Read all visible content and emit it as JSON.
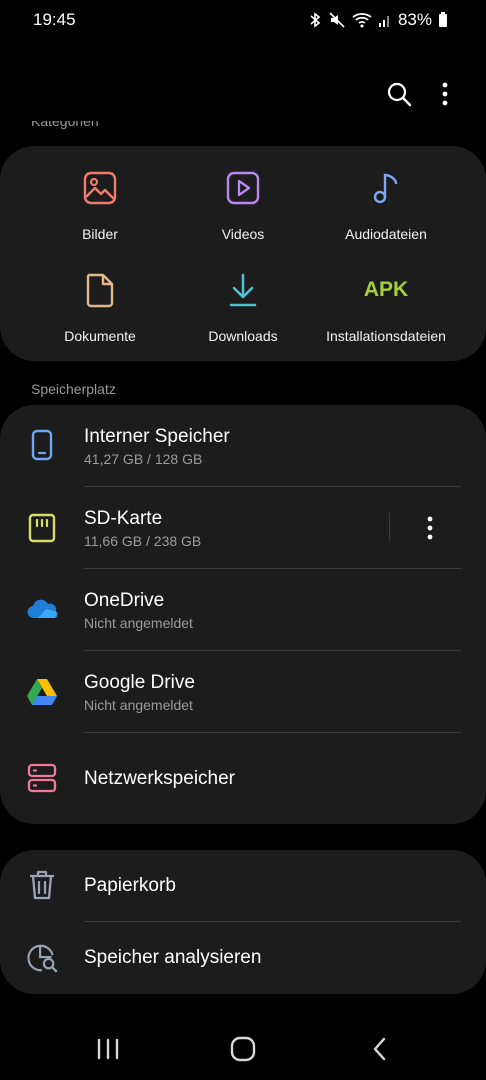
{
  "status": {
    "time": "19:45",
    "battery": "83%",
    "icons": [
      "bluetooth-icon",
      "mute-icon",
      "wifi-icon",
      "signal-icon",
      "battery-icon"
    ]
  },
  "toolbar": {
    "icons": [
      "search-icon",
      "more-options-icon"
    ]
  },
  "categories": {
    "header": "Kategorien",
    "items": [
      {
        "label": "Bilder",
        "icon": "image-icon",
        "color": "#f07d6c"
      },
      {
        "label": "Videos",
        "icon": "video-icon",
        "color": "#b889f0"
      },
      {
        "label": "Audiodateien",
        "icon": "audio-icon",
        "color": "#7ea6f4"
      },
      {
        "label": "Dokumente",
        "icon": "document-icon",
        "color": "#e3b989"
      },
      {
        "label": "Downloads",
        "icon": "download-icon",
        "color": "#4fc3d6"
      },
      {
        "label": "Installationsdateien",
        "icon": "apk-icon",
        "apk_text": "APK",
        "color": "#a6d03a"
      }
    ]
  },
  "storage": {
    "header": "Speicherplatz",
    "items": [
      {
        "title": "Interner Speicher",
        "subtitle": "41,27 GB / 128 GB",
        "icon": "phone-icon",
        "color": "#6ea8f0"
      },
      {
        "title": "SD-Karte",
        "subtitle": "11,66 GB / 238 GB",
        "icon": "sd-card-icon",
        "color": "#d7dc6a"
      },
      {
        "title": "OneDrive",
        "subtitle": "Nicht angemeldet",
        "icon": "onedrive-icon",
        "color": "#2a8ee6"
      },
      {
        "title": "Google Drive",
        "subtitle": "Nicht angemeldet",
        "icon": "google-drive-icon",
        "color": "#34a853"
      },
      {
        "title": "Netzwerkspeicher",
        "subtitle": "",
        "icon": "network-storage-icon",
        "color": "#f07a9a"
      }
    ]
  },
  "tools": {
    "items": [
      {
        "title": "Papierkorb",
        "icon": "trash-icon"
      },
      {
        "title": "Speicher analysieren",
        "icon": "analyze-storage-icon"
      }
    ]
  },
  "navbar": {
    "icons": [
      "recent-apps-icon",
      "home-icon",
      "back-icon"
    ]
  }
}
